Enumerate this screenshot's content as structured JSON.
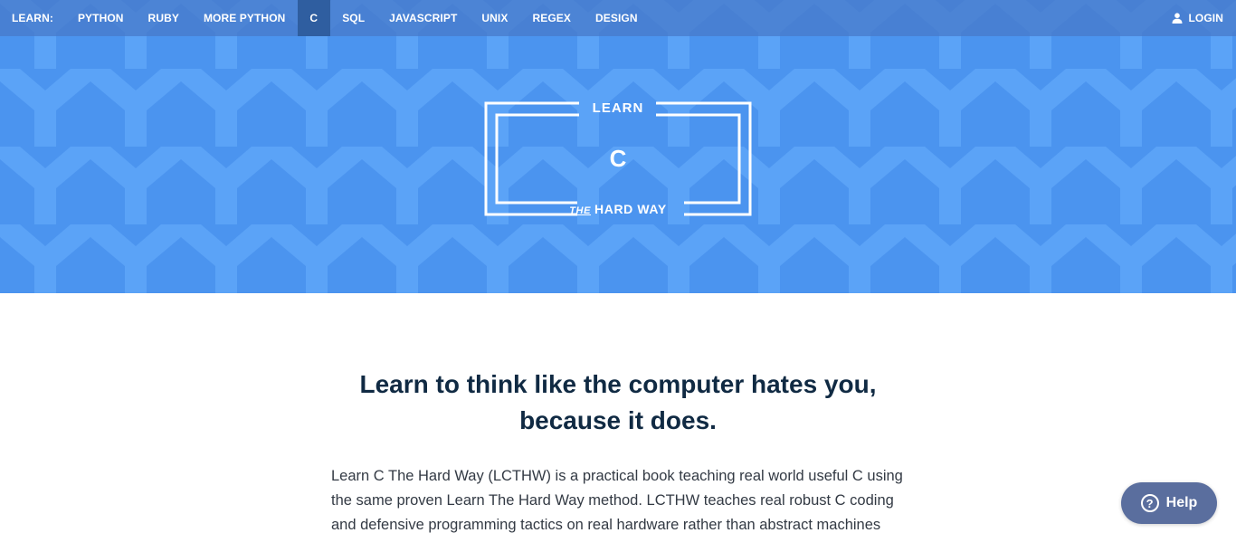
{
  "nav": {
    "learn_label": "LEARN:",
    "items": [
      {
        "label": "PYTHON",
        "active": false
      },
      {
        "label": "RUBY",
        "active": false
      },
      {
        "label": "MORE PYTHON",
        "active": false
      },
      {
        "label": "C",
        "active": true
      },
      {
        "label": "SQL",
        "active": false
      },
      {
        "label": "JAVASCRIPT",
        "active": false
      },
      {
        "label": "UNIX",
        "active": false
      },
      {
        "label": "REGEX",
        "active": false
      },
      {
        "label": "DESIGN",
        "active": false
      }
    ],
    "login_label": "LOGIN",
    "login_icon": "user-icon"
  },
  "logo": {
    "top": "LEARN",
    "middle": "C",
    "the": "THE",
    "bottom": "HARD WAY"
  },
  "main": {
    "headline_line1": "Learn to think like the computer hates you,",
    "headline_line2": "because it does.",
    "intro": "Learn C The Hard Way (LCTHW) is a practical book teaching real world useful C using the same proven Learn The Hard Way method. LCTHW teaches real robust C coding and defensive programming tactics on real hardware rather than abstract machines"
  },
  "help": {
    "label": "Help",
    "icon": "question-circle-icon",
    "glyph": "?"
  },
  "colors": {
    "hero": "#4b94ef",
    "pattern": "#5ba3f7",
    "nav_active": "#2f5ea0",
    "headline": "#102a43",
    "help_bg": "#5a6e9e"
  }
}
